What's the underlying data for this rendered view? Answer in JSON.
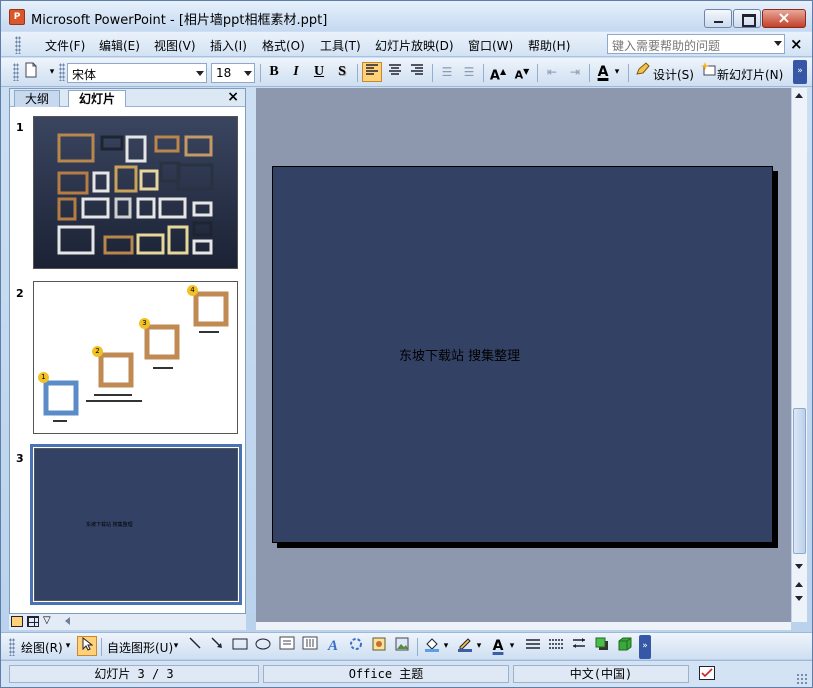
{
  "window": {
    "title": "Microsoft PowerPoint - [相片墙ppt相框素材.ppt]",
    "app_icon_label": "P"
  },
  "menubar": {
    "items": [
      "文件(F)",
      "编辑(E)",
      "视图(V)",
      "插入(I)",
      "格式(O)",
      "工具(T)",
      "幻灯片放映(D)",
      "窗口(W)",
      "帮助(H)"
    ],
    "help_placeholder": "键入需要帮助的问题",
    "close_label": "×"
  },
  "toolbar": {
    "font_name": "宋体",
    "font_size": "18",
    "bold": "B",
    "italic": "I",
    "underline": "U",
    "shadow": "S",
    "design_label": "设计(S)",
    "new_slide_label": "新幻灯片(N)"
  },
  "leftpane": {
    "tab_outline": "大纲",
    "tab_slides": "幻灯片",
    "close_label": "×",
    "slides": [
      {
        "num": "1"
      },
      {
        "num": "2",
        "badges": [
          "1",
          "2",
          "3",
          "4"
        ]
      },
      {
        "num": "3",
        "text": "东坡下载站 搜集整理"
      }
    ]
  },
  "slide": {
    "text": "东坡下载站 搜集整理",
    "background": "#334165"
  },
  "drawbar": {
    "draw_label": "绘图(R)",
    "autoshape_label": "自选图形(U)"
  },
  "statusbar": {
    "slide_pos": "幻灯片 3 / 3",
    "theme": "Office 主题",
    "language": "中文(中国)"
  },
  "colors": {
    "accent": "#4a73b5",
    "editor_bg": "#8d97ad",
    "toolbar_active": "#ffd27a"
  }
}
